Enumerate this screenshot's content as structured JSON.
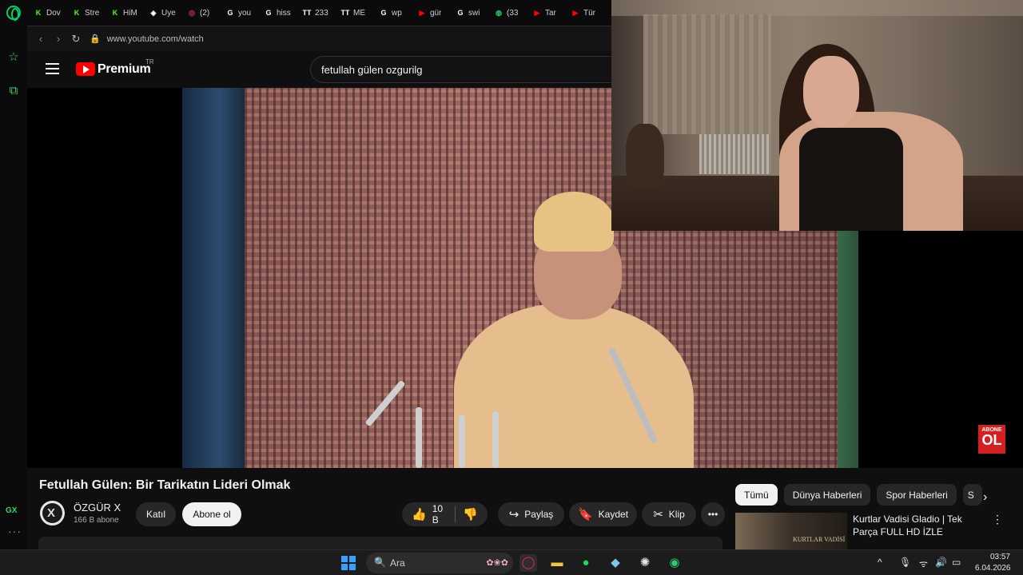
{
  "browser": {
    "tabs": [
      {
        "label": "Dov",
        "icon": "kick-icon",
        "color": "#53fc18"
      },
      {
        "label": "Stre",
        "icon": "kick-icon",
        "color": "#53fc18"
      },
      {
        "label": "HiM",
        "icon": "kick-icon",
        "color": "#53fc18"
      },
      {
        "label": "Uye",
        "icon": "github-icon",
        "color": "#ffffff"
      },
      {
        "label": "(2)",
        "icon": "instagram-icon",
        "color": "#e1306c"
      },
      {
        "label": "you",
        "icon": "google-icon",
        "color": "#ffffff"
      },
      {
        "label": "hiss",
        "icon": "google-icon",
        "color": "#ffffff"
      },
      {
        "label": "233",
        "icon": "tt-icon",
        "color": "#ffffff"
      },
      {
        "label": "ME",
        "icon": "tt-icon",
        "color": "#ffffff"
      },
      {
        "label": "wp",
        "icon": "google-icon",
        "color": "#ffffff"
      },
      {
        "label": "gür",
        "icon": "youtube-icon",
        "color": "#ff0000"
      },
      {
        "label": "swi",
        "icon": "google-icon",
        "color": "#ffffff"
      },
      {
        "label": "(33",
        "icon": "whatsapp-icon",
        "color": "#25d366"
      },
      {
        "label": "Tar",
        "icon": "youtube-icon",
        "color": "#ff0000"
      },
      {
        "label": "Tür",
        "icon": "youtube-icon",
        "color": "#ff0000"
      }
    ],
    "url": "www.youtube.com/watch",
    "sidebar_label": "GX"
  },
  "youtube": {
    "brand": "Premium",
    "country": "TR",
    "search_query": "fetullah gülen  ozgurilg",
    "video_badge_top": "ABONE",
    "video_badge_bottom": "OL",
    "video_title": "Fetullah Gülen: Bir Tarikatın Lideri Olmak",
    "channel": {
      "name": "ÖZGÜR X",
      "subscribers": "166 B abone",
      "join_label": "Katıl",
      "subscribe_label": "Abone ol"
    },
    "actions": {
      "likes": "10 B",
      "share": "Paylaş",
      "save": "Kaydet",
      "clip": "Klip"
    },
    "chips": [
      "Tümü",
      "Dünya Haberleri",
      "Spor Haberleri",
      "S"
    ],
    "recommendation": {
      "title": "Kurtlar Vadisi Gladio | Tek Parça FULL HD İZLE",
      "thumb_text": "KURTLAR VADİSİ"
    }
  },
  "taskbar": {
    "search_placeholder": "Ara",
    "time": "03:57",
    "date": "6.04.2026"
  },
  "colors": {
    "accent_green": "#3ed26f",
    "youtube_red": "#ff0000",
    "background": "#0f0f0f"
  }
}
